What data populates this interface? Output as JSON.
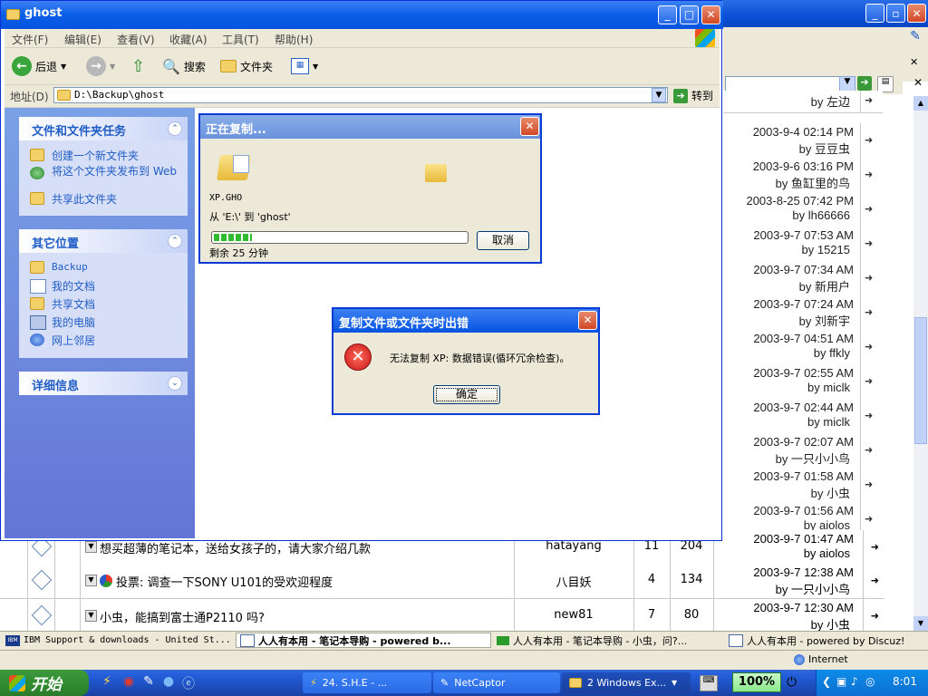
{
  "explorer": {
    "title": "ghost",
    "menu": [
      "文件(F)",
      "编辑(E)",
      "查看(V)",
      "收藏(A)",
      "工具(T)",
      "帮助(H)"
    ],
    "toolbar": {
      "back": "后退",
      "search": "搜索",
      "folders": "文件夹"
    },
    "address_label": "地址(D)",
    "address_value": "D:\\Backup\\ghost",
    "go_label": "转到",
    "tasks_panel": {
      "title": "文件和文件夹任务",
      "items": [
        "创建一个新文件夹",
        "将这个文件夹发布到 Web",
        "共享此文件夹"
      ]
    },
    "places_panel": {
      "title": "其它位置",
      "items": [
        "Backup",
        "我的文档",
        "共享文档",
        "我的电脑",
        "网上邻居"
      ]
    },
    "details_panel": {
      "title": "详细信息"
    }
  },
  "copy_dialog": {
    "title": "正在复制...",
    "filename": "XP.GHO",
    "from_to": "从 'E:\\' 到 'ghost'",
    "remaining": "剩余 25 分钟",
    "cancel": "取消",
    "progress": 0.15
  },
  "error_dialog": {
    "title": "复制文件或文件夹时出错",
    "message": "无法复制 XP: 数据错误(循环冗余检查)。",
    "ok": "确定"
  },
  "forum_right": [
    {
      "date": "",
      "by": "by 左边"
    },
    {
      "date": "2003-9-4 02:14 PM",
      "by": "by 豆豆虫"
    },
    {
      "date": "2003-9-6 03:16 PM",
      "by": "by 鱼缸里的鸟"
    },
    {
      "date": "2003-8-25 07:42 PM",
      "by": "by lh66666"
    },
    {
      "date": "2003-9-7 07:53 AM",
      "by": "by 15215"
    },
    {
      "date": "2003-9-7 07:34 AM",
      "by": "by 新用户"
    },
    {
      "date": "2003-9-7 07:24 AM",
      "by": "by 刘新宇"
    },
    {
      "date": "2003-9-7 04:51 AM",
      "by": "by ffkly"
    },
    {
      "date": "2003-9-7 02:55 AM",
      "by": "by miclk"
    },
    {
      "date": "2003-9-7 02:44 AM",
      "by": "by miclk"
    },
    {
      "date": "2003-9-7 02:07 AM",
      "by": "by 一只小小鸟"
    },
    {
      "date": "2003-9-7 01:58 AM",
      "by": "by 小虫"
    },
    {
      "date": "2003-9-7 01:56 AM",
      "by": "by aiolos"
    }
  ],
  "forum_bottom": [
    {
      "title": "想买超薄的笔记本，送给女孩子的，请大家介绍几款",
      "author": "hatayang",
      "replies": "11",
      "views": "204",
      "date": "2003-9-7 01:47 AM",
      "by": "by aiolos"
    },
    {
      "title": "投票: 调查一下SONY U101的受欢迎程度",
      "author": "八目妖",
      "replies": "4",
      "views": "134",
      "date": "2003-9-7 12:38 AM",
      "by": "by 一只小小鸟"
    },
    {
      "title": "小虫，能搞到富士通P2110 吗?",
      "author": "new81",
      "replies": "7",
      "views": "80",
      "date": "2003-9-7 12:30 AM",
      "by": "by 小虫"
    }
  ],
  "browser_tabs": [
    "IBM Support & downloads - United St...",
    "人人有本用 - 笔记本导购 - powered b...",
    "人人有本用 - 笔记本导购 - 小虫，问?...",
    "人人有本用 - powered by Discuz!"
  ],
  "status_zone": "Internet",
  "taskbar": {
    "start": "开始",
    "tasks": [
      "24. S.H.E - ...",
      "NetCaptor",
      "2 Windows Ex..."
    ],
    "zoom": "100%",
    "clock": "8:01"
  },
  "colors": {
    "xp_blue": "#0a5ee8",
    "task_pane": "#7aa1e6",
    "error_red": "#c81818"
  }
}
